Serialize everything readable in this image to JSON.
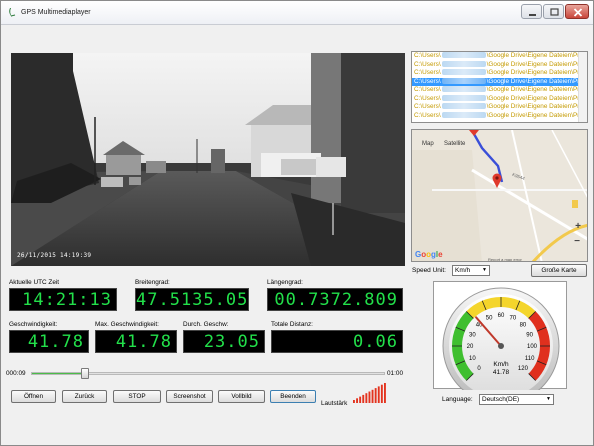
{
  "window": {
    "title": "GPS Multimediaplayer"
  },
  "video": {
    "timestamp": "26/11/2015 14:19:39"
  },
  "file_list": {
    "items": [
      {
        "prefix": "C:\\Users\\",
        "suffix": "\\Google Drive\\Eigene Dateien\\Pro",
        "selected": false
      },
      {
        "prefix": "C:\\Users\\",
        "suffix": "\\Google Drive\\Eigene Dateien\\Pro",
        "selected": false
      },
      {
        "prefix": "C:\\Users\\",
        "suffix": "\\Google Drive\\Eigene Dateien\\Pro",
        "selected": false
      },
      {
        "prefix": "C:\\Users\\",
        "suffix": "\\Google Drive\\Eigene Dateien\\Pro",
        "selected": true
      },
      {
        "prefix": "C:\\Users\\",
        "suffix": "\\Google Drive\\Eigene Dateien\\Pro",
        "selected": false
      },
      {
        "prefix": "C:\\Users\\",
        "suffix": "\\Google Drive\\Eigene Dateien\\Pro",
        "selected": false
      },
      {
        "prefix": "C:\\Users\\",
        "suffix": "\\Google Drive\\Eigene Dateien\\Pro",
        "selected": false
      },
      {
        "prefix": "C:\\Users\\",
        "suffix": "\\Google Drive\\Eigene Dateien\\Pro",
        "selected": false
      }
    ]
  },
  "map": {
    "tab_map": "Map",
    "tab_satellite": "Satellite",
    "road_label": "K9544",
    "logo": "Google",
    "footer": "Report a map error",
    "zoom_in": "+",
    "zoom_out": "−"
  },
  "speed_unit": {
    "label": "Speed Unit:",
    "value": "Km/h"
  },
  "big_map_button": "Große Karte",
  "stats": {
    "utc_label": "Aktuelle UTC Zeit",
    "utc_value": "14:21:13",
    "lat_label": "Breitengrad:",
    "lat_value": "47.5135.05",
    "lon_label": "Längengrad:",
    "lon_value": "00.7372.809",
    "speed_label": "Geschwindigkeit:",
    "speed_value": "41.78",
    "max_speed_label": "Max. Geschwindigkeit:",
    "max_speed_value": "41.78",
    "avg_speed_label": "Durch. Geschw:",
    "avg_speed_value": "23.05",
    "distance_label": "Totale Distanz:",
    "distance_value": "0.06"
  },
  "gauge": {
    "unit": "Km/h",
    "value": 41.78,
    "value_text": "41.78",
    "ticks": [
      "0",
      "10",
      "20",
      "30",
      "40",
      "50",
      "60",
      "70",
      "80",
      "90",
      "100",
      "110",
      "120"
    ]
  },
  "playback": {
    "elapsed": "000:09",
    "total": "01:00",
    "progress_fraction": 0.15
  },
  "buttons": {
    "open": "Öffnen",
    "back": "Zurück",
    "stop": "STOP",
    "screenshot": "Screenshot",
    "fullscreen": "Vollbild",
    "quit": "Beenden"
  },
  "volume": {
    "label": "Lautstärk",
    "level_fraction": 1.0
  },
  "language": {
    "label": "Language:",
    "value": "Deutsch(DE)"
  },
  "colors": {
    "lcd_text": "#22e04a",
    "selection": "#3399ff",
    "route": "#3a4fd8",
    "marker": "#e03a2c"
  }
}
